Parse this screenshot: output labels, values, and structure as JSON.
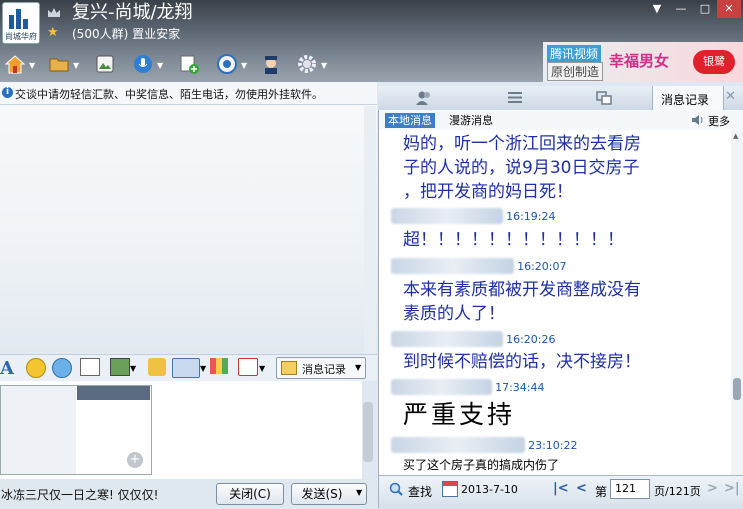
{
  "window": {
    "group_name": "复兴-尚城/龙翔",
    "group_desc": "(500人群) 置业安家",
    "logo_text": "尚城华府",
    "controls": [
      "▼",
      "—",
      "□",
      "✕"
    ]
  },
  "toolbar": {
    "icons": [
      "home-icon",
      "folder-icon",
      "album-icon",
      "voice-icon",
      "app-icon",
      "camera-icon",
      "police-icon",
      "gear-icon"
    ]
  },
  "ad": {
    "brand": "腾讯视频",
    "sub": "原创制造",
    "title": "幸福男女",
    "badge": "银鹭"
  },
  "notice": {
    "text": "交谈中请勿轻信汇款、中奖信息、陌生电话，勿使用外挂软件。"
  },
  "input_toolbar": {
    "msg_record_label": "消息记录"
  },
  "bottom": {
    "signature": "冰冻三尺仅一日之寒! 仅仅仅!",
    "close_label": "关闭(C)",
    "send_label": "发送(S)"
  },
  "right_panel": {
    "tab_active": "消息记录",
    "subtab_local": "本地消息",
    "subtab_roam": "漫游消息",
    "more": "更多"
  },
  "messages": [
    {
      "lines": [
        "妈的，听一个浙江回来的去看房",
        "子的人说的，说9月30日交房子",
        "，把开发商的妈日死！"
      ]
    },
    {
      "time": "16:19:24",
      "lines": [
        "超！！！！！！！！！！！！"
      ]
    },
    {
      "time": "16:20:07",
      "lines": [
        "本来有素质都被开发商整成没有",
        "素质的人了！"
      ]
    },
    {
      "time": "16:20:26",
      "lines": [
        "到时候不赔偿的话，决不接房！"
      ]
    },
    {
      "time": "17:34:44",
      "lines": [
        "严重支持"
      ]
    },
    {
      "time": "23:10:22",
      "lines": [
        "买了这个房子真的搞成内伤了"
      ]
    }
  ],
  "footer": {
    "search": "查找",
    "date": "2013-7-10",
    "page_prefix": "第",
    "page_current": "121",
    "page_total": "页/121页"
  }
}
